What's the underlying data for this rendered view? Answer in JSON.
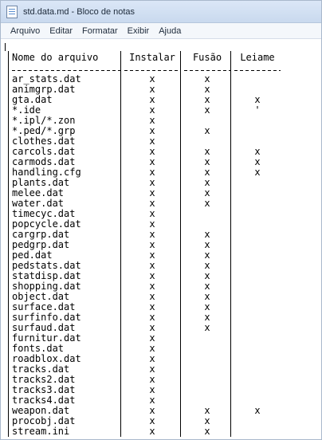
{
  "window": {
    "title": "std.data.md - Bloco de notas"
  },
  "menu": {
    "items": [
      "Arquivo",
      "Editar",
      "Formatar",
      "Exibir",
      "Ajuda"
    ]
  },
  "table": {
    "headers": [
      "Nome do arquivo",
      "Instalar",
      "Fusão",
      "Leiame"
    ],
    "rows": [
      [
        "ar_stats.dat",
        "x",
        "x",
        ""
      ],
      [
        "animgrp.dat",
        "x",
        "x",
        ""
      ],
      [
        "gta.dat",
        "x",
        "x",
        "x"
      ],
      [
        "*.ide",
        "x",
        "x",
        "'"
      ],
      [
        "*.ipl/*.zon",
        "x",
        "",
        ""
      ],
      [
        "*.ped/*.grp",
        "x",
        "x",
        ""
      ],
      [
        "clothes.dat",
        "x",
        "",
        ""
      ],
      [
        "carcols.dat",
        "x",
        "x",
        "x"
      ],
      [
        "carmods.dat",
        "x",
        "x",
        "x"
      ],
      [
        "handling.cfg",
        "x",
        "x",
        "x"
      ],
      [
        "plants.dat",
        "x",
        "x",
        ""
      ],
      [
        "melee.dat",
        "x",
        "x",
        ""
      ],
      [
        "water.dat",
        "x",
        "x",
        ""
      ],
      [
        "timecyc.dat",
        "x",
        "",
        ""
      ],
      [
        "popcycle.dat",
        "x",
        "",
        ""
      ],
      [
        "cargrp.dat",
        "x",
        "x",
        ""
      ],
      [
        "pedgrp.dat",
        "x",
        "x",
        ""
      ],
      [
        "ped.dat",
        "x",
        "x",
        ""
      ],
      [
        "pedstats.dat",
        "x",
        "x",
        ""
      ],
      [
        "statdisp.dat",
        "x",
        "x",
        ""
      ],
      [
        "shopping.dat",
        "x",
        "x",
        ""
      ],
      [
        "object.dat",
        "x",
        "x",
        ""
      ],
      [
        "surface.dat",
        "x",
        "x",
        ""
      ],
      [
        "surfinfo.dat",
        "x",
        "x",
        ""
      ],
      [
        "surfaud.dat",
        "x",
        "x",
        ""
      ],
      [
        "furnitur.dat",
        "x",
        "",
        ""
      ],
      [
        "fonts.dat",
        "x",
        "",
        ""
      ],
      [
        "roadblox.dat",
        "x",
        "",
        ""
      ],
      [
        "tracks.dat",
        "x",
        "",
        ""
      ],
      [
        "tracks2.dat",
        "x",
        "",
        ""
      ],
      [
        "tracks3.dat",
        "x",
        "",
        ""
      ],
      [
        "tracks4.dat",
        "x",
        "",
        ""
      ],
      [
        "weapon.dat",
        "x",
        "x",
        "x"
      ],
      [
        "procobj.dat",
        "x",
        "x",
        ""
      ],
      [
        "stream.ini",
        "x",
        "x",
        ""
      ]
    ]
  }
}
